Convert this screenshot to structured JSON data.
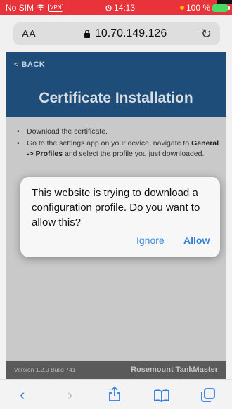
{
  "status_bar": {
    "carrier": "No SIM",
    "vpn": "VPN",
    "time": "14:13",
    "battery": "100 %"
  },
  "browser": {
    "text_size_label": "AA",
    "url": "10.70.149.126"
  },
  "page": {
    "back_label": "< BACK",
    "title": "Certificate Installation",
    "items": [
      {
        "text_before": "Download the certificate.",
        "bold": "",
        "text_after": ""
      },
      {
        "text_before": "Go to the settings app on your device, navigate to ",
        "bold": "General -> Profiles",
        "text_after": " and select the profile you just downloaded."
      }
    ],
    "footer": {
      "version": "Version 1.2.0 Build 741",
      "brand": "Rosemount TankMaster"
    }
  },
  "dialog": {
    "message": "This website is trying to download a configuration profile. Do you want to allow this?",
    "ignore_label": "Ignore",
    "allow_label": "Allow"
  },
  "colors": {
    "status_bar": "#e8333a",
    "header": "#1d4d78",
    "accent": "#2f7fd8"
  },
  "toolbar": {
    "icons": [
      "back-icon",
      "forward-icon",
      "share-icon",
      "bookmarks-icon",
      "tabs-icon"
    ]
  }
}
